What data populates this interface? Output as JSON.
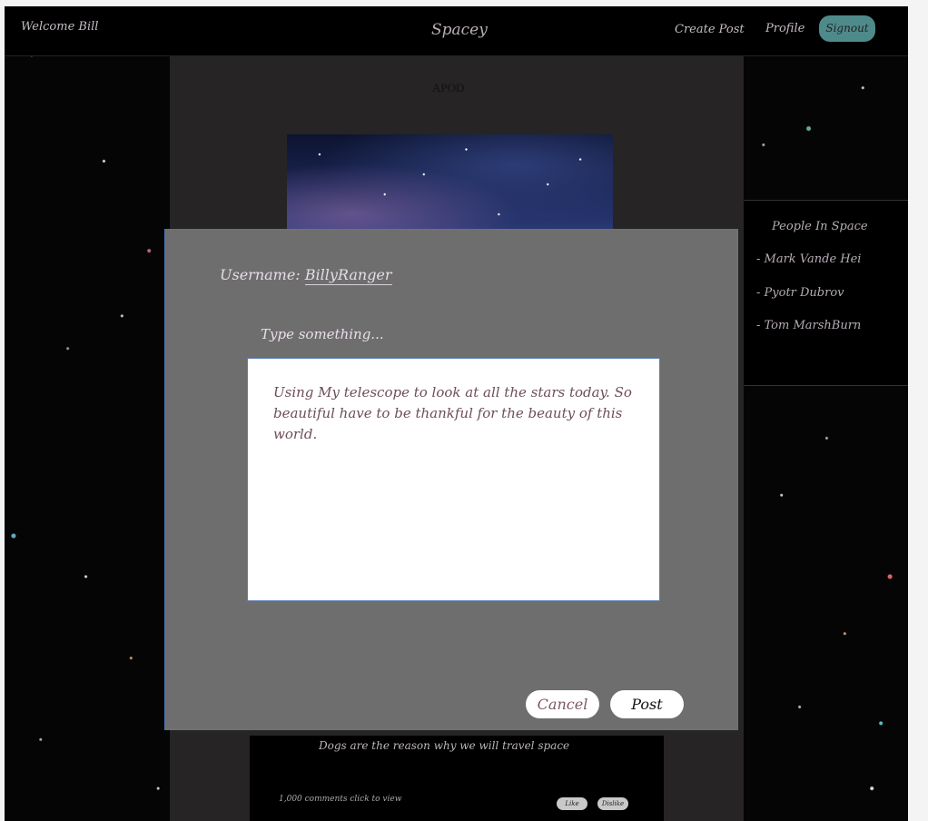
{
  "header": {
    "welcome": "Welcome Bill",
    "brand": "Spacey",
    "nav_create_post": "Create Post",
    "nav_profile": "Profile",
    "signout": "Signout"
  },
  "feed": {
    "apod_label": "APOD",
    "post_text": "Dogs are the reason why we will travel space",
    "comments": "1,000 comments click to view",
    "like": "Like",
    "dislike": "Dislike"
  },
  "people_in_space": {
    "title": "People In Space",
    "items": [
      "- Mark Vande Hei",
      "- Pyotr Dubrov",
      "- Tom MarshBurn"
    ]
  },
  "modal": {
    "username_label": "Username:",
    "username_value": "BillyRanger",
    "type_label": "Type something...",
    "textbox_text": "Using My telescope to look at all the stars today. So beautiful have to be thankful for the beauty of this world.",
    "cancel": "Cancel",
    "post": "Post"
  },
  "colors": {
    "signout_bg": "#4f8a8a",
    "modal_bg": "#6e6e6e",
    "modal_border": "#4a78b8"
  }
}
